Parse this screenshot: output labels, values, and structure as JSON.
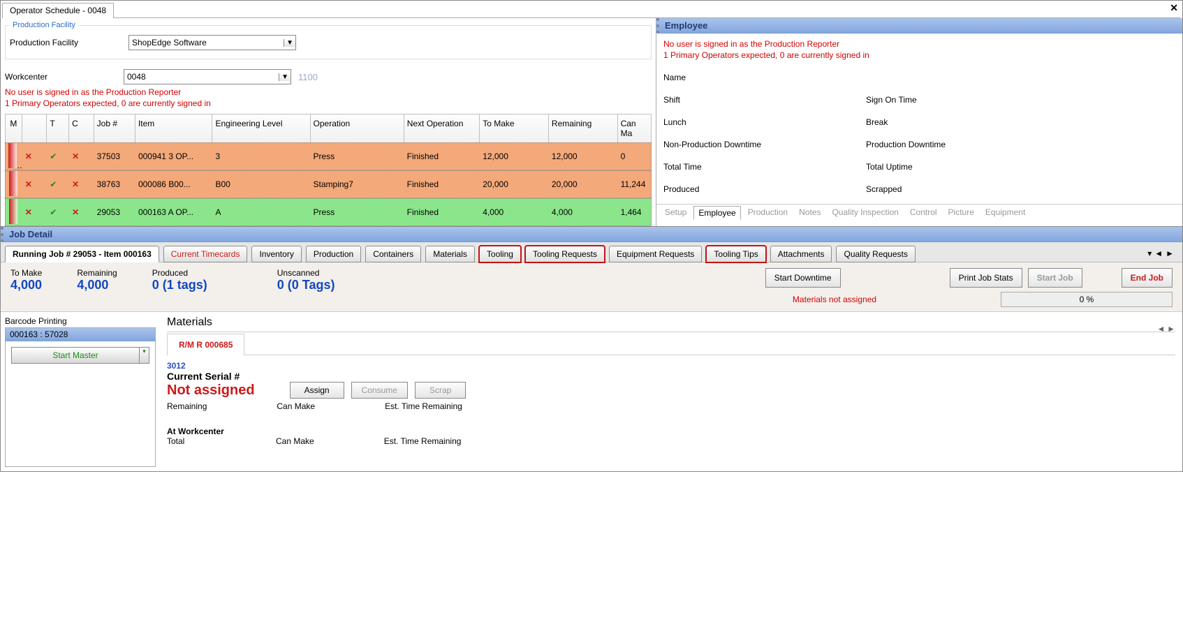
{
  "window": {
    "tab_title": "Operator Schedule - 0048",
    "close": "✕"
  },
  "facility": {
    "legend": "Production Facility",
    "facility_label": "Production Facility",
    "facility_value": "ShopEdge Software",
    "workcenter_label": "Workcenter",
    "workcenter_value": "0048",
    "workcenter_hint": "1100",
    "error1": "No user is signed in as the Production Reporter",
    "error2": "1 Primary Operators expected, 0 are currently signed in"
  },
  "grid": {
    "headers": {
      "m": "M",
      "t": "T",
      "c": "C",
      "job": "Job #",
      "item": "Item",
      "eng": "Engineering Level",
      "op": "Operation",
      "nop": "Next Operation",
      "tmk": "To Make",
      "rem": "Remaining",
      "cm": "Can Ma"
    },
    "rows": [
      {
        "job": "37503",
        "item": "000941  3  OP...",
        "eng": "3",
        "op": "Press",
        "nop": "Finished",
        "tmk": "12,000",
        "rem": "12,000",
        "cm": "0",
        "color": "orange",
        "ptr": true
      },
      {
        "job": "38763",
        "item": "000086  B00...",
        "eng": "B00",
        "op": "Stamping7",
        "nop": "Finished",
        "tmk": "20,000",
        "rem": "20,000",
        "cm": "11,244",
        "color": "orange",
        "ptr": false
      },
      {
        "job": "29053",
        "item": "000163  A  OP...",
        "eng": "A",
        "op": "Press",
        "nop": "Finished",
        "tmk": "4,000",
        "rem": "4,000",
        "cm": "1,464",
        "color": "green",
        "ptr": false
      }
    ]
  },
  "employee": {
    "title": "Employee",
    "error1": "No user is signed in as the Production Reporter",
    "error2": "1 Primary Operators expected, 0 are currently signed in",
    "name_l": "Name",
    "shift_l": "Shift",
    "signon_l": "Sign On Time",
    "lunch_l": "Lunch",
    "break_l": "Break",
    "npd_l": "Non-Production Downtime",
    "pd_l": "Production Downtime",
    "tt_l": "Total Time",
    "tu_l": "Total Uptime",
    "prod_l": "Produced",
    "scrap_l": "Scrapped",
    "tabs": [
      "Setup",
      "Employee",
      "Production",
      "Notes",
      "Quality Inspection",
      "Control",
      "Picture",
      "Equipment"
    ]
  },
  "job": {
    "section_title": "Job Detail",
    "tabs": [
      {
        "label": "Running Job # 29053 - Item 000163",
        "active": true
      },
      {
        "label": "Current Timecards",
        "red": true
      },
      {
        "label": "Inventory"
      },
      {
        "label": "Production"
      },
      {
        "label": "Containers"
      },
      {
        "label": "Materials"
      },
      {
        "label": "Tooling",
        "hl": true
      },
      {
        "label": "Tooling Requests",
        "hl": true
      },
      {
        "label": "Equipment Requests"
      },
      {
        "label": "Tooling Tips",
        "hl": true
      },
      {
        "label": "Attachments"
      },
      {
        "label": "Quality Requests"
      }
    ],
    "nav": {
      "more": "▾",
      "left": "◄",
      "right": "►"
    },
    "summary": {
      "to_make_l": "To Make",
      "to_make_v": "4,000",
      "remaining_l": "Remaining",
      "remaining_v": "4,000",
      "produced_l": "Produced",
      "produced_v": "0 (1 tags)",
      "unscanned_l": "Unscanned",
      "unscanned_v": "0 (0 Tags)",
      "start_dt": "Start Downtime",
      "print_stats": "Print Job Stats",
      "start_job": "Start Job",
      "end_job": "End Job",
      "materials_err": "Materials not assigned",
      "progress": "0 %"
    },
    "barcode": {
      "section": "Barcode Printing",
      "header": "000163 : 57028",
      "btn": "Start Master"
    },
    "materials": {
      "section": "Materials",
      "tab": "R/M R 000685",
      "code": "3012",
      "cs_label": "Current Serial #",
      "na": "Not assigned",
      "assign": "Assign",
      "consume": "Consume",
      "scrap": "Scrap",
      "remaining_l": "Remaining",
      "canmake_l": "Can Make",
      "etr_l": "Est. Time Remaining",
      "atwc": "At Workcenter",
      "total_l": "Total"
    }
  }
}
